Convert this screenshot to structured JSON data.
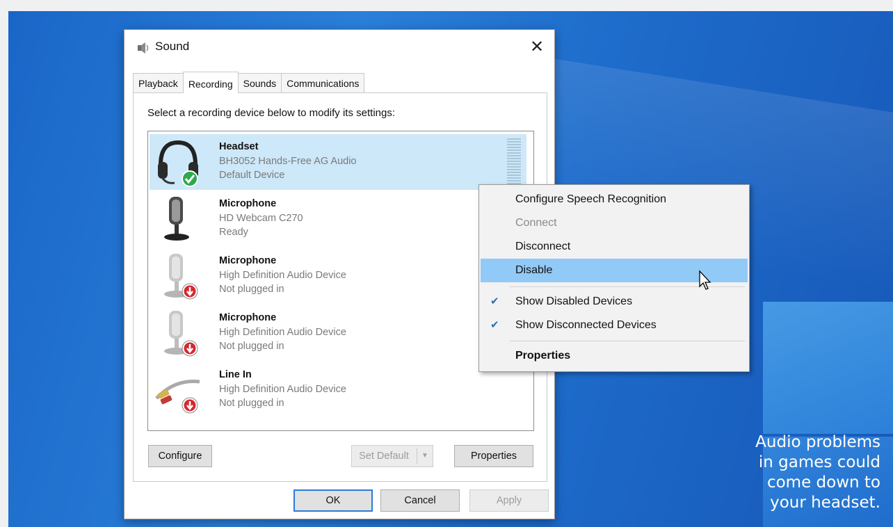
{
  "caption": {
    "line1": "Audio problems",
    "line2": "in games could",
    "line3": "come down to",
    "line4": "your headset."
  },
  "dialog": {
    "title": "Sound",
    "close_label": "✕",
    "tabs": [
      {
        "label": "Playback"
      },
      {
        "label": "Recording"
      },
      {
        "label": "Sounds"
      },
      {
        "label": "Communications"
      }
    ],
    "instruction": "Select a recording device below to modify its settings:",
    "devices": [
      {
        "name": "Headset",
        "line1": "BH3052 Hands-Free AG Audio",
        "line2": "Default Device",
        "status_icon": "check-badge-icon"
      },
      {
        "name": "Microphone",
        "line1": "HD Webcam C270",
        "line2": "Ready",
        "status_icon": ""
      },
      {
        "name": "Microphone",
        "line1": "High Definition Audio Device",
        "line2": "Not plugged in",
        "status_icon": "down-arrow-badge-icon"
      },
      {
        "name": "Microphone",
        "line1": "High Definition Audio Device",
        "line2": "Not plugged in",
        "status_icon": "down-arrow-badge-icon"
      },
      {
        "name": "Line In",
        "line1": "High Definition Audio Device",
        "line2": "Not plugged in",
        "status_icon": "down-arrow-badge-icon"
      }
    ],
    "buttons": {
      "configure": "Configure",
      "set_default": "Set Default",
      "properties": "Properties",
      "ok": "OK",
      "cancel": "Cancel",
      "apply": "Apply"
    }
  },
  "context_menu": {
    "items": [
      {
        "label": "Configure Speech Recognition",
        "state": "normal"
      },
      {
        "label": "Connect",
        "state": "disabled"
      },
      {
        "label": "Disconnect",
        "state": "normal"
      },
      {
        "label": "Disable",
        "state": "highlighted"
      },
      {
        "label": "Show Disabled Devices",
        "state": "checked"
      },
      {
        "label": "Show Disconnected Devices",
        "state": "checked"
      },
      {
        "label": "Properties",
        "state": "bold"
      }
    ]
  },
  "colors": {
    "selection": "#cde8f8",
    "menu_highlight": "#91c9f7",
    "desktop": "#1e6ccb"
  }
}
